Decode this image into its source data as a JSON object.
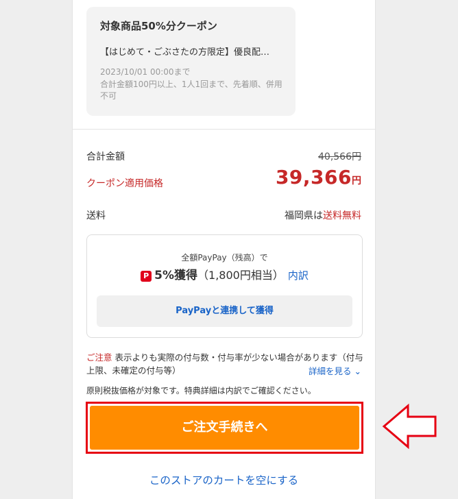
{
  "coupon": {
    "title": "対象商品50%分クーポン",
    "description": "【はじめて・ごぶさたの方限定】優良配…",
    "expiry": "2023/10/01 00:00まで",
    "conditions": "合計金額100円以上、1人1回まで、先着順、併用不可"
  },
  "totals": {
    "total_label": "合計金額",
    "total_original": "40,566",
    "total_yen": "円",
    "coupon_price_label": "クーポン適用価格",
    "coupon_price": "39,366",
    "coupon_price_yen": "円"
  },
  "shipping": {
    "label": "送料",
    "region": "福岡県は",
    "free": "送料無料"
  },
  "paypay": {
    "line1": "全額PayPay（残高）で",
    "icon_char": "P",
    "percent": "5%獲得",
    "amount": "（1,800円相当）",
    "breakdown_link": "内訳",
    "link_button": "PayPayと連携して獲得"
  },
  "notice": {
    "caution_label": "ご注意",
    "caution_text": " 表示よりも実際の付与数・付与率が少ない場合があります（付与上限、未確定の付与等）",
    "detail_link": "詳細を見る ⌄",
    "tax_note": "原則税抜価格が対象です。特典詳細は内訳でご確認ください。"
  },
  "actions": {
    "order_button": "ご注文手続きへ",
    "empty_cart": "このストアのカートを空にする"
  },
  "colors": {
    "price_red": "#c62828",
    "link_blue": "#1a64c8",
    "order_orange": "#ff8c00",
    "highlight_red": "#e60012"
  },
  "icons": {
    "paypay": "paypay-icon",
    "arrow": "left-arrow-icon"
  }
}
